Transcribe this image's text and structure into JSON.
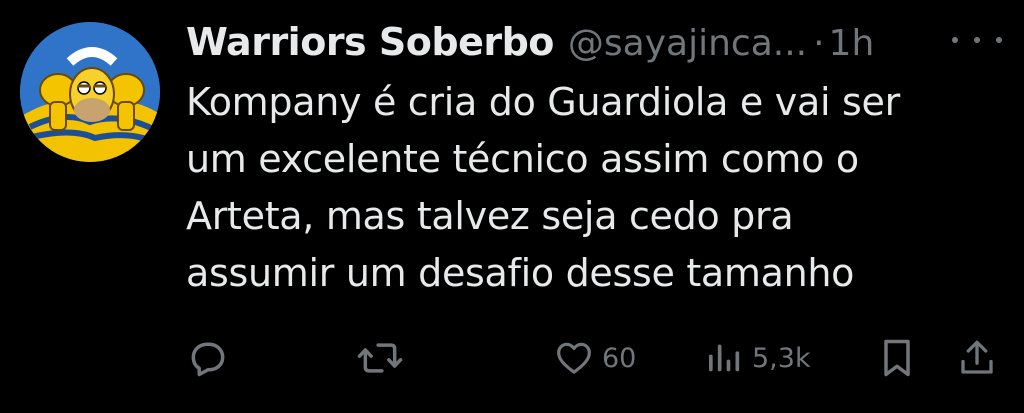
{
  "user": {
    "display_name": "Warriors Soberbo",
    "handle": "@sayajinca...",
    "separator": "·",
    "time": "1h",
    "avatar_icon": "homer-simpson-avatar"
  },
  "tweet": {
    "lines": [
      "Kompany é cria do Guardiola e vai ser",
      "um excelente técnico assim como o",
      "Arteta, mas talvez seja cedo pra",
      "assumir um desafio desse tamanho"
    ]
  },
  "actions": {
    "reply": {
      "icon": "reply-icon",
      "count": ""
    },
    "retweet": {
      "icon": "retweet-icon",
      "count": ""
    },
    "like": {
      "icon": "heart-icon",
      "count": "60"
    },
    "views": {
      "icon": "views-icon",
      "count": "5,3k"
    },
    "bookmark": {
      "icon": "bookmark-icon"
    },
    "share": {
      "icon": "share-icon"
    }
  },
  "colors": {
    "background": "#000000",
    "text_primary": "#e7e9ea",
    "text_secondary": "#71767b"
  }
}
